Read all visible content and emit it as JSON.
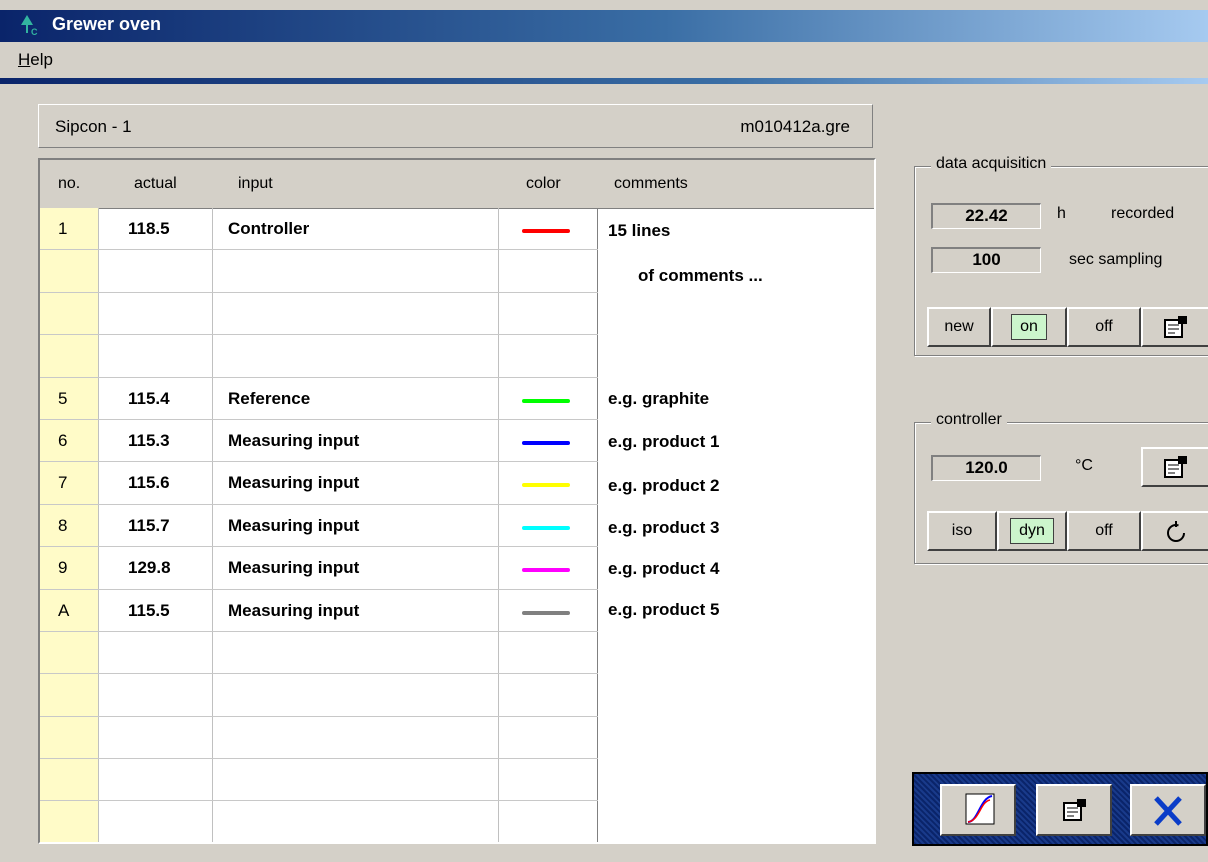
{
  "window": {
    "title": "Grewer oven"
  },
  "menu": {
    "help_prefix": "H",
    "help_rest": "elp"
  },
  "info": {
    "device": "Sipcon - 1",
    "file": "m010412a.gre"
  },
  "table": {
    "headers": {
      "no": "no.",
      "actual": "actual",
      "input": "input",
      "color": "color",
      "comments": "comments"
    },
    "rows": [
      {
        "no": "1",
        "actual": "118.5",
        "input": "Controller",
        "color": "#ff0000"
      },
      {
        "no": "",
        "actual": "",
        "input": "",
        "color": ""
      },
      {
        "no": "",
        "actual": "",
        "input": "",
        "color": ""
      },
      {
        "no": "",
        "actual": "",
        "input": "",
        "color": ""
      },
      {
        "no": "5",
        "actual": "115.4",
        "input": "Reference",
        "color": "#00ff00"
      },
      {
        "no": "6",
        "actual": "115.3",
        "input": "Measuring input",
        "color": "#0000ff"
      },
      {
        "no": "7",
        "actual": "115.6",
        "input": "Measuring input",
        "color": "#ffff00"
      },
      {
        "no": "8",
        "actual": "115.7",
        "input": "Measuring input",
        "color": "#00ffff"
      },
      {
        "no": "9",
        "actual": "129.8",
        "input": "Measuring input",
        "color": "#ff00ff"
      },
      {
        "no": "A",
        "actual": "115.5",
        "input": "Measuring input",
        "color": "#808080"
      },
      {
        "no": "",
        "actual": "",
        "input": "",
        "color": ""
      },
      {
        "no": "",
        "actual": "",
        "input": "",
        "color": ""
      },
      {
        "no": "",
        "actual": "",
        "input": "",
        "color": ""
      },
      {
        "no": "",
        "actual": "",
        "input": "",
        "color": ""
      },
      {
        "no": "",
        "actual": "",
        "input": "",
        "color": ""
      }
    ],
    "comments": {
      "line1": "15 lines",
      "line2": "of comments ...",
      "c5": "e.g. graphite",
      "c6": "e.g. product 1",
      "c7": "e.g. product 2",
      "c8": "e.g. product 3",
      "c9": "e.g. product 4",
      "cA": "e.g. product 5"
    }
  },
  "data_acquisition": {
    "legend": "data acquisiticn",
    "recorded_value": "22.42",
    "recorded_unit": "h",
    "recorded_label": "recorded",
    "sampling_value": "100",
    "sampling_label": "sec sampling",
    "btn_new": "new",
    "btn_on": "on",
    "btn_off": "off"
  },
  "controller": {
    "legend": "controller",
    "temp_value": "120.0",
    "temp_unit": "°C",
    "btn_iso": "iso",
    "btn_dyn": "dyn",
    "btn_off": "off"
  },
  "icons": {
    "app": "grewer-app-icon",
    "properties": "properties-icon",
    "reset": "reset-circle-icon",
    "graph": "graph-chart-icon",
    "close": "close-x-icon"
  }
}
